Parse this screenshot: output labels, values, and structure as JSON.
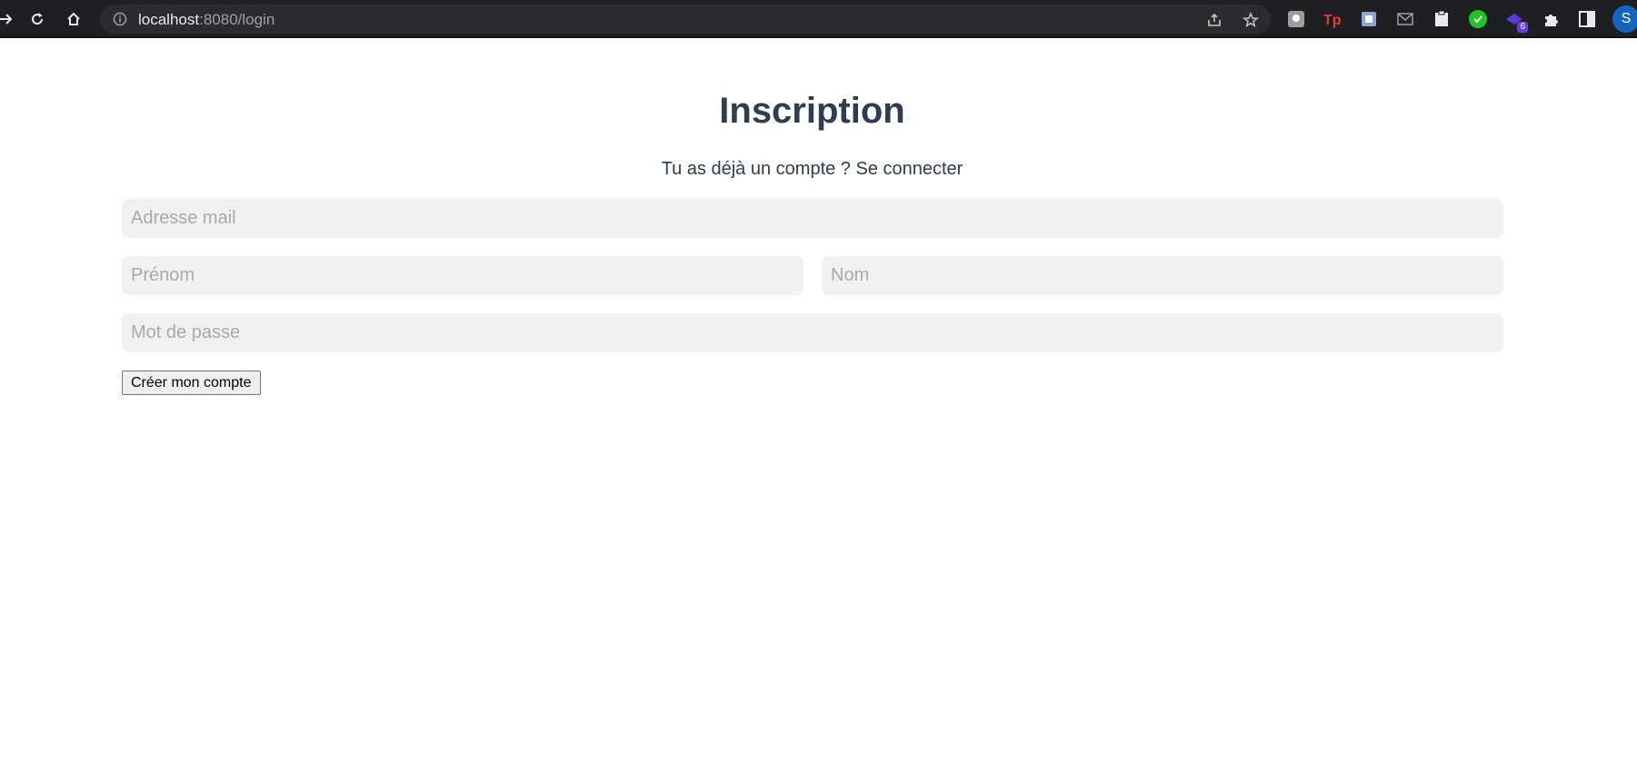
{
  "browser": {
    "url_host": "localhost",
    "url_rest": ":8080/login",
    "extension_badge": "6",
    "profile_initial": "S",
    "icons": [
      "back-arrow-icon",
      "reload-icon",
      "home-icon",
      "info-icon",
      "share-icon",
      "star-icon",
      "extensions-puzzle-icon",
      "side-panel-icon"
    ]
  },
  "page": {
    "title": "Inscription",
    "subtitle_prefix": "Tu as déjà un compte ? ",
    "login_link": "Se connecter"
  },
  "form": {
    "email_placeholder": "Adresse mail",
    "firstname_placeholder": "Prénom",
    "lastname_placeholder": "Nom",
    "password_placeholder": "Mot de passe",
    "submit_label": "Créer mon compte"
  },
  "colors": {
    "heading": "#2c3e50",
    "input_bg": "#f1f1f1",
    "toolbar_bg": "#1e1f22"
  }
}
